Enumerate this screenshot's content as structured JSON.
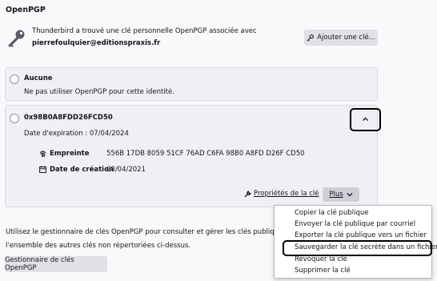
{
  "section_title": "OpenPGP",
  "personal_key_notice": {
    "line1": "Thunderbird a trouvé une clé personnelle OpenPGP associée avec",
    "email": "pierrefoulquier@editionspraxis.fr"
  },
  "add_key_button": {
    "label": "Ajouter une clé..."
  },
  "option_none": {
    "title": "Aucune",
    "description": "Ne pas utiliser OpenPGP pour cette identité."
  },
  "option_key": {
    "key_id": "0x98B0A8FDD26FCD50",
    "expiration": "Date d'expiration : 07/04/2024",
    "fingerprint_label": "Empreinte",
    "fingerprint_value": "556B 17DB 8059 51CF 76AD C6FA 98B0 A8FD D26F CD50",
    "created_label": "Date de création",
    "created_value": "08/04/2021",
    "properties_button": "Propriétés de la clé",
    "more_button": "Plus",
    "collapse_glyph": "^"
  },
  "footer": {
    "text_line1": "Utilisez le gestionnaire de clés OpenPGP pour consulter et gérer les clés publiques de v",
    "text_line2": "l'ensemble des autres clés non répertoriées ci-dessus.",
    "manager_button": "Gestionnaire de clés OpenPGP"
  },
  "menu": {
    "items": [
      "Copier la clé publique",
      "Envoyer la clé publique par courriel",
      "Exporter la clé publique vers un fichier",
      "Sauvegarder la clé secrète dans un fichier",
      "Révoquer la clé",
      "Supprimer la clé"
    ]
  },
  "icons": {
    "key": "key-icon",
    "fingerprint": "fingerprint-icon",
    "calendar": "calendar-icon",
    "wrench": "wrench-icon",
    "chevron_up": "chevron-up-icon",
    "chevron_down": "chevron-down-icon"
  },
  "colors": {
    "highlight_border": "#000000",
    "panel_bg": "#f0f0f4",
    "page_bg": "#f9f9fb"
  }
}
